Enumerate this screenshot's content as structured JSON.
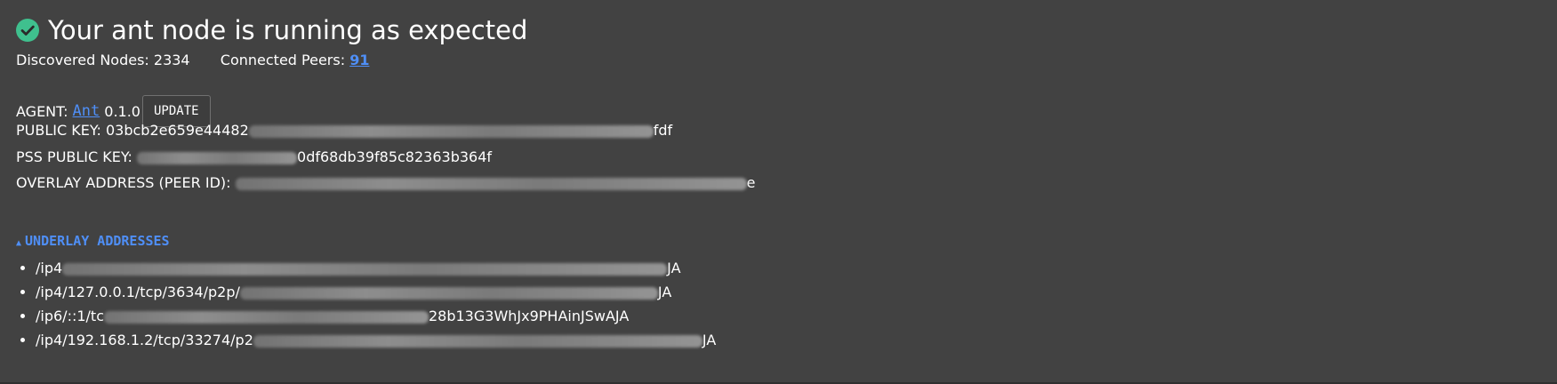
{
  "header": {
    "title": "Your ant node is running as expected",
    "status_color": "#3fc08e",
    "icon": "check-circle-icon"
  },
  "stats": {
    "discovered_label": "Discovered Nodes:",
    "discovered_value": "2334",
    "connected_label": "Connected Peers:",
    "connected_value": "91"
  },
  "agent": {
    "label": "AGENT:",
    "name": "Ant",
    "version": "0.1.0",
    "update_label": "UPDATE"
  },
  "keys": {
    "public_key_label": "PUBLIC KEY:",
    "public_key_start": "03bcb2e659e44482",
    "public_key_end": "fdf",
    "pss_label": "PSS PUBLIC KEY:",
    "pss_end": "0df68db39f85c82363b364f",
    "overlay_label": "OVERLAY ADDRESS (PEER ID):",
    "overlay_end": "e"
  },
  "underlay": {
    "toggle_label": "UNDERLAY ADDRESSES",
    "addresses": [
      {
        "start": "/ip4",
        "end": "JA"
      },
      {
        "start": "/ip4/127.0.0.1/tcp/3634/p2p/",
        "end": "JA"
      },
      {
        "start": "/ip6/::1/tc",
        "end": "28b13G3WhJx9PHAinJSwAJA"
      },
      {
        "start": "/ip4/192.168.1.2/tcp/33274/p2",
        "end": "JA"
      }
    ]
  },
  "colors": {
    "background": "#424242",
    "link": "#4f8ff7",
    "text": "#ffffff"
  }
}
